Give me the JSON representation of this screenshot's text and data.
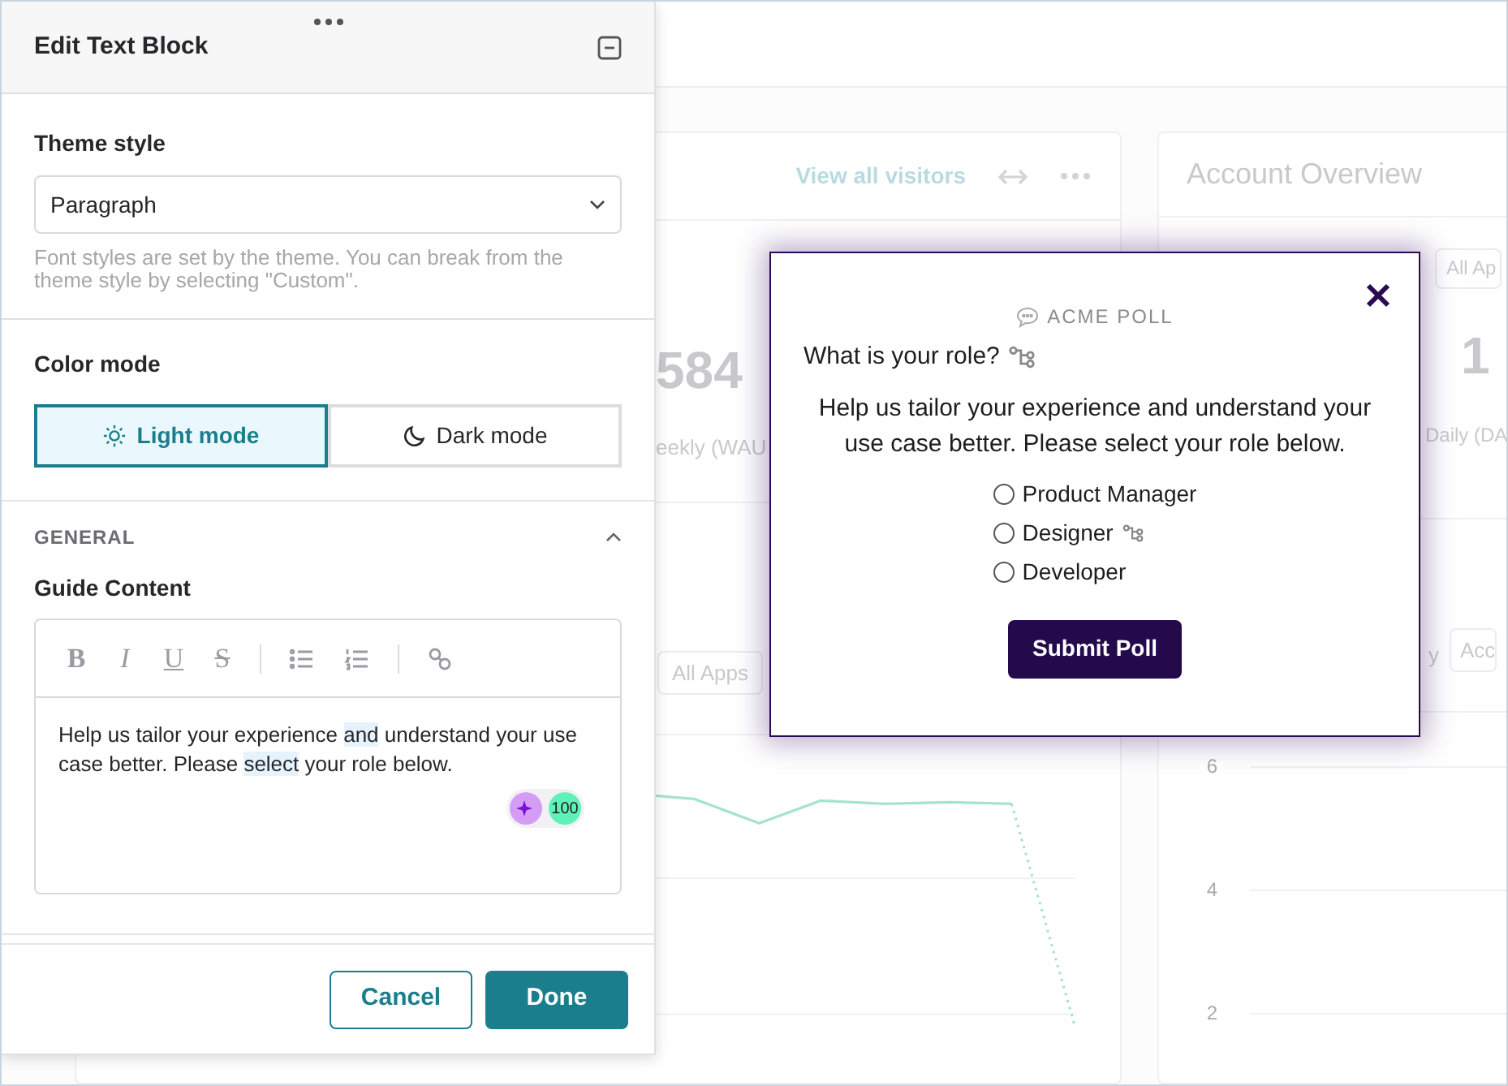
{
  "dashboard": {
    "visitors_card": {
      "link": "View all visitors",
      "stat_value": "584",
      "stat_label": "eekly (WAU",
      "filter": "All Apps"
    },
    "account_card": {
      "title": "Account Overview",
      "filter_top": "All Ap",
      "stat_value": "1",
      "stat_label": "Daily (DA",
      "filter_label": "y",
      "filter": "Acc",
      "y_ticks": [
        "6",
        "4",
        "2"
      ]
    }
  },
  "editor": {
    "title": "Edit Text Block",
    "theme_style": {
      "label": "Theme style",
      "value": "Paragraph",
      "help": "Font styles are set by the theme. You can break from the theme style by selecting \"Custom\"."
    },
    "color_mode": {
      "label": "Color mode",
      "options": [
        {
          "label": "Light mode",
          "kind": "light",
          "selected": true
        },
        {
          "label": "Dark mode",
          "kind": "dark",
          "selected": false
        }
      ]
    },
    "general": {
      "heading": "GENERAL",
      "expanded": true,
      "content_label": "Guide Content",
      "toolbar": [
        {
          "kind": "bold",
          "label": "B"
        },
        {
          "kind": "italic",
          "label": "I"
        },
        {
          "kind": "underline",
          "label": "U"
        },
        {
          "kind": "strike",
          "label": "S"
        },
        {
          "kind": "divider"
        },
        {
          "kind": "bullets"
        },
        {
          "kind": "numbers"
        },
        {
          "kind": "divider"
        },
        {
          "kind": "link"
        }
      ],
      "segments": [
        {
          "text": "Help us tailor your experience ",
          "highlighted": false
        },
        {
          "text": "and",
          "highlighted": true
        },
        {
          "text": " understand your use case better. Please ",
          "highlighted": false
        },
        {
          "text": "select",
          "highlighted": true
        },
        {
          "text": " your role below.",
          "highlighted": false
        }
      ],
      "score": "100"
    },
    "buttons": [
      {
        "label": "Cancel",
        "kind": "secondary"
      },
      {
        "label": "Done",
        "kind": "primary"
      }
    ]
  },
  "poll": {
    "brand": "ACME POLL",
    "question": "What is your role?",
    "description": "Help us tailor your experience and understand your use case better. Please select your role below.",
    "options": [
      {
        "label": "Product Manager",
        "selected": false,
        "branching": false
      },
      {
        "label": "Designer",
        "selected": false,
        "branching": true
      },
      {
        "label": "Developer",
        "selected": false,
        "branching": false
      }
    ],
    "submit": "Submit Poll"
  }
}
